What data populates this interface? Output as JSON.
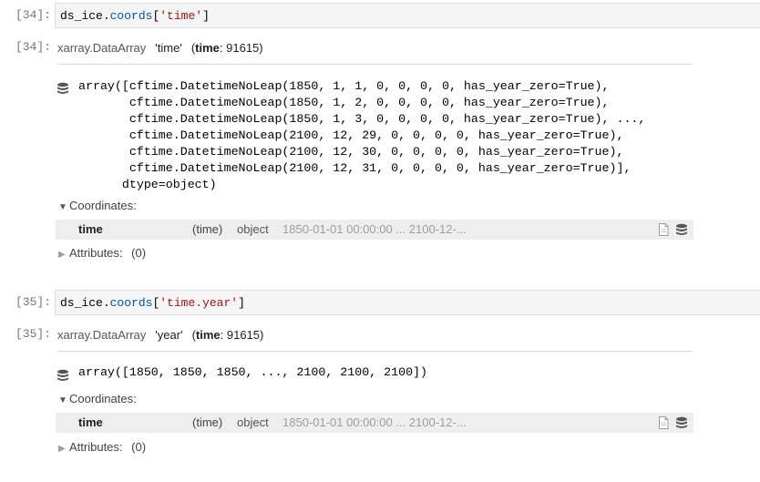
{
  "cells": [
    {
      "in_prompt": "[34]:",
      "code": {
        "var": "ds_ice",
        "dot": ".",
        "attr": "coords",
        "open": "[",
        "str": "'time'",
        "close": "]"
      },
      "out_prompt": "[34]:",
      "header": {
        "type": "xarray.DataArray",
        "name": "'time'",
        "dims_open": "(",
        "dim_name": "time",
        "dim_rest": ": 91615)"
      },
      "array_lines": [
        "array([cftime.DatetimeNoLeap(1850, 1, 1, 0, 0, 0, 0, has_year_zero=True),",
        "       cftime.DatetimeNoLeap(1850, 1, 2, 0, 0, 0, 0, has_year_zero=True),",
        "       cftime.DatetimeNoLeap(1850, 1, 3, 0, 0, 0, 0, has_year_zero=True), ...,",
        "       cftime.DatetimeNoLeap(2100, 12, 29, 0, 0, 0, 0, has_year_zero=True),",
        "       cftime.DatetimeNoLeap(2100, 12, 30, 0, 0, 0, 0, has_year_zero=True),",
        "       cftime.DatetimeNoLeap(2100, 12, 31, 0, 0, 0, 0, has_year_zero=True)],",
        "      dtype=object)"
      ],
      "coordinates_label": "Coordinates:",
      "coord": {
        "name": "time",
        "dims": "(time)",
        "dtype": "object",
        "preview": "1850-01-01 00:00:00 ... 2100-12-..."
      },
      "attributes_label": "Attributes:",
      "attributes_count": "(0)"
    },
    {
      "in_prompt": "[35]:",
      "code": {
        "var": "ds_ice",
        "dot": ".",
        "attr": "coords",
        "open": "[",
        "str": "'time.year'",
        "close": "]"
      },
      "out_prompt": "[35]:",
      "header": {
        "type": "xarray.DataArray",
        "name": "'year'",
        "dims_open": "(",
        "dim_name": "time",
        "dim_rest": ": 91615)"
      },
      "array_lines": [
        "array([1850, 1850, 1850, ..., 2100, 2100, 2100])"
      ],
      "coordinates_label": "Coordinates:",
      "coord": {
        "name": "time",
        "dims": "(time)",
        "dtype": "object",
        "preview": "1850-01-01 00:00:00 ... 2100-12-..."
      },
      "attributes_label": "Attributes:",
      "attributes_count": "(0)"
    }
  ],
  "icons": {
    "database": "database-icon",
    "file": "file-icon",
    "expanded": "triangle-down-icon",
    "collapsed": "triangle-right-icon"
  }
}
